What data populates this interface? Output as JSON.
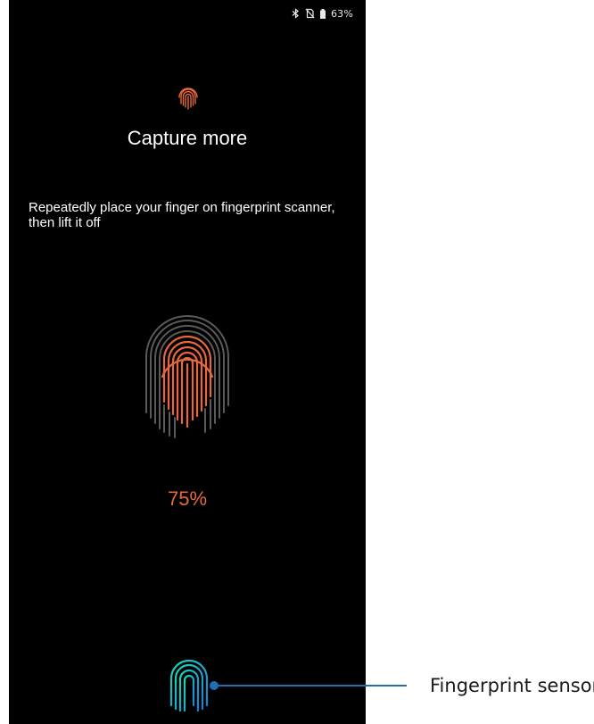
{
  "status_bar": {
    "icons": [
      "bluetooth-icon",
      "no-sim-icon",
      "battery-icon"
    ],
    "battery": "63%"
  },
  "screen": {
    "title": "Capture more",
    "instruction": "Repeatedly place your finger on fingerprint scanner, then lift it off",
    "progress": "75%",
    "progress_value": 0.75
  },
  "callout": {
    "label": "Fingerprint sensor"
  },
  "colors": {
    "screen_bg": "#000000",
    "accent_orange": "#e8673c",
    "print_gray": "#5a5a5a",
    "callout_blue": "#1f6fb5",
    "sensor_teal": "#19c4c0"
  }
}
